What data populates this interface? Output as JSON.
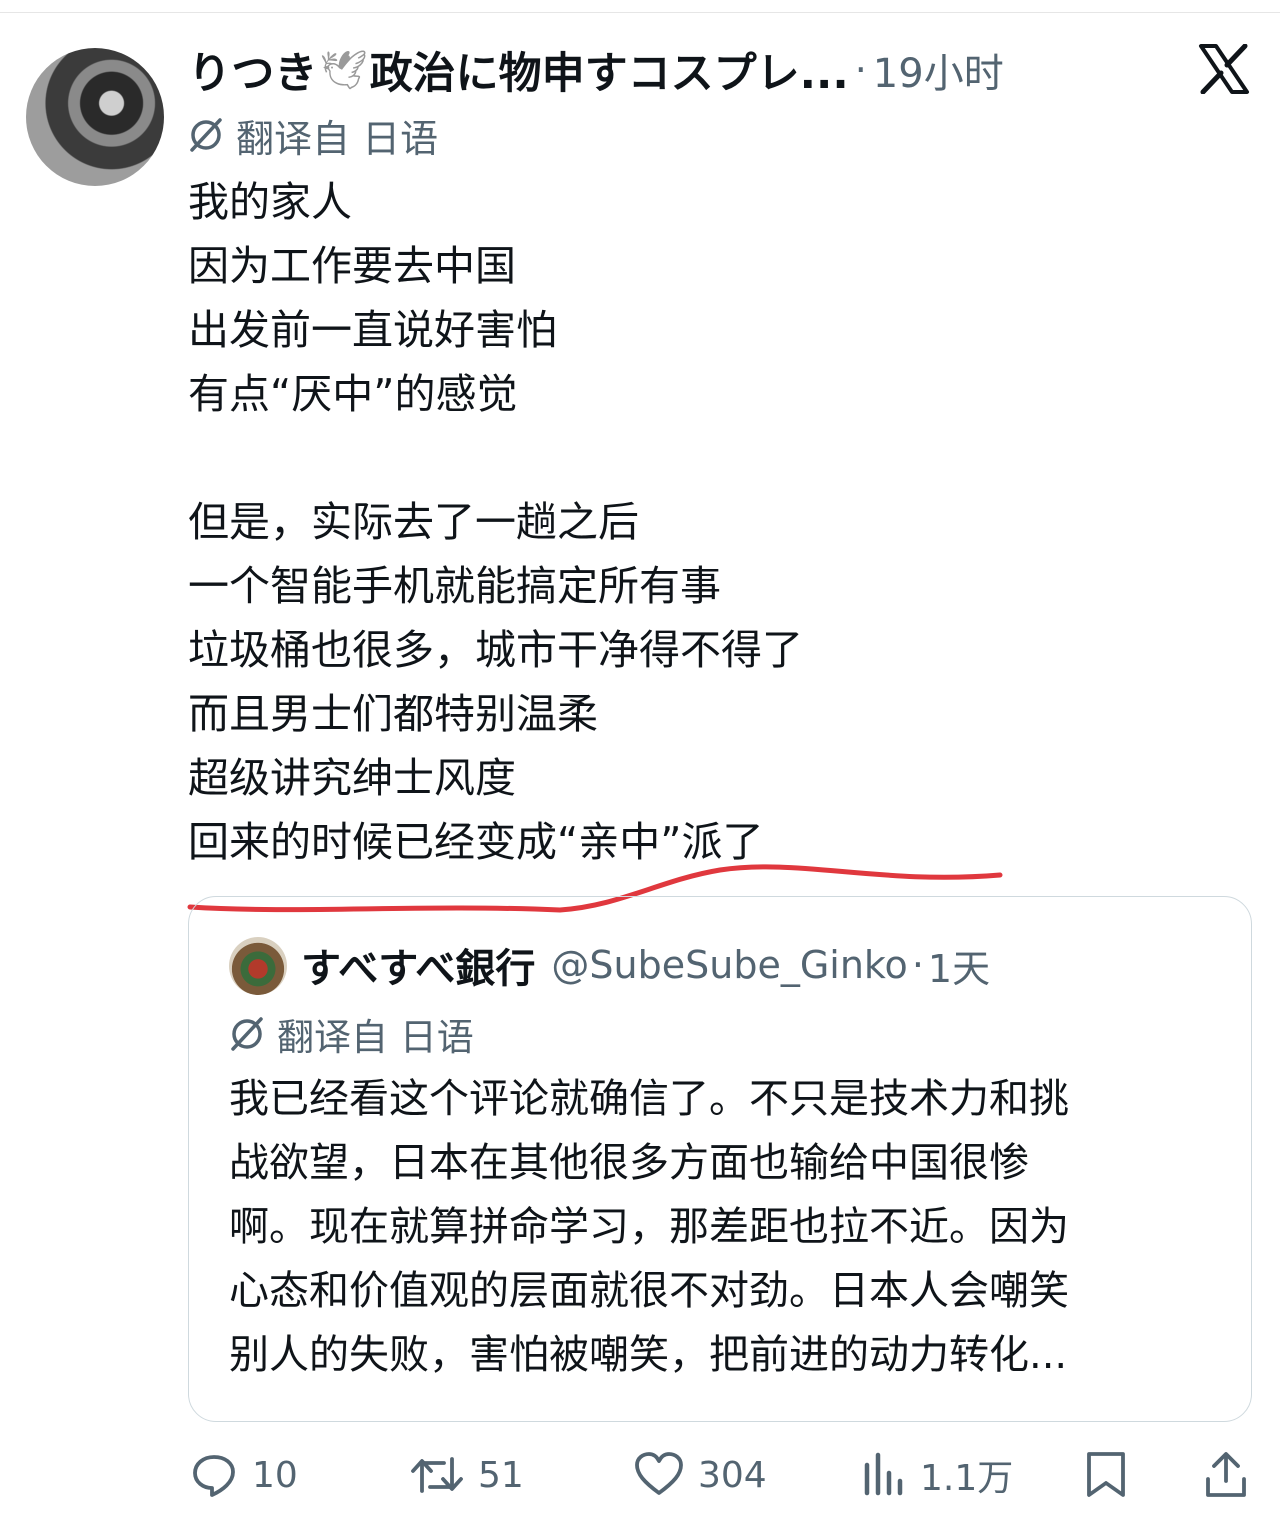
{
  "post": {
    "display_name": "りつき",
    "display_name_suffix": "政治に物申すコスプレ...",
    "separator": "·",
    "time": "19小时",
    "translate_label": "翻译自 日语",
    "body_lines": [
      "我的家人",
      "因为工作要去中国",
      "出发前一直说好害怕",
      "有点“厌中”的感觉",
      "",
      "但是，实际去了一趟之后",
      "一个智能手机就能搞定所有事",
      "垃圾桶也很多，城市干净得不得了",
      "而且男士们都特别温柔",
      "超级讲究绅士风度",
      "回来的时候已经变成“亲中”派了"
    ]
  },
  "quote": {
    "display_name": "すべすべ銀行",
    "handle": "@SubeSube_Ginko",
    "separator": "·",
    "time": "1天",
    "translate_label": "翻译自 日语",
    "body_lines": [
      "我已经看这个评论就确信了。不只是技术力和挑",
      "战欲望，日本在其他很多方面也输给中国很惨",
      "啊。现在就算拼命学习，那差距也拉不近。因为",
      "心态和价值观的层面就很不对劲。日本人会嘲笑",
      "别人的失败，害怕被嘲笑，把前进的动力转化..."
    ]
  },
  "actions": {
    "reply_count": "10",
    "repost_count": "51",
    "like_count": "304",
    "view_count": "1.1万"
  },
  "icons": {
    "dove": "dove-emoji-icon",
    "x_logo": "x-logo-icon",
    "translate": "translate-globe-icon",
    "reply": "reply-bubble-icon",
    "repost": "repost-arrows-icon",
    "like": "heart-icon",
    "views": "views-bar-chart-icon",
    "bookmark": "bookmark-icon",
    "share": "share-upload-icon"
  },
  "colors": {
    "text": "#0f1419",
    "secondary": "#536471",
    "annotation_underline": "#e0383e",
    "card_border": "#cfd9de"
  }
}
